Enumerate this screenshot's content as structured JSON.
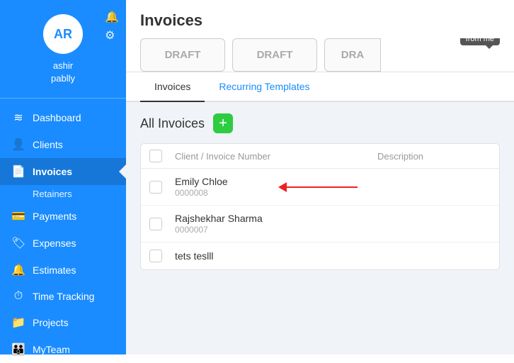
{
  "sidebar": {
    "avatar_initials": "AR",
    "username": "ashir",
    "company": "pablly",
    "nav_items": [
      {
        "id": "dashboard",
        "label": "Dashboard",
        "icon": "👤"
      },
      {
        "id": "clients",
        "label": "Clients",
        "icon": "👥"
      },
      {
        "id": "invoices",
        "label": "Invoices",
        "icon": "📄",
        "active": true
      },
      {
        "id": "retainers",
        "label": "Retainers",
        "sub": true
      },
      {
        "id": "payments",
        "label": "Payments",
        "icon": "💳"
      },
      {
        "id": "expenses",
        "label": "Expenses",
        "icon": "🏷"
      },
      {
        "id": "estimates",
        "label": "Estimates",
        "icon": "🔔"
      },
      {
        "id": "time-tracking",
        "label": "Time Tracking",
        "icon": "⏱"
      },
      {
        "id": "projects",
        "label": "Projects",
        "icon": "📁"
      },
      {
        "id": "my-team",
        "label": "MyTeam",
        "icon": "👪"
      }
    ]
  },
  "header": {
    "title": "Invoices",
    "draft_badges": [
      "DRAFT",
      "DRAFT",
      "DRA"
    ],
    "from_me_tooltip": "from me"
  },
  "tabs": [
    {
      "id": "invoices",
      "label": "Invoices",
      "active": true
    },
    {
      "id": "recurring",
      "label": "Recurring Templates",
      "highlighted": true
    }
  ],
  "all_invoices": {
    "section_title": "All Invoices",
    "add_btn_label": "+",
    "columns": [
      {
        "id": "client",
        "label": "Client / Invoice Number"
      },
      {
        "id": "desc",
        "label": "Description"
      }
    ],
    "rows": [
      {
        "name": "Emily Chloe",
        "invoice": "0000008",
        "has_arrow": true
      },
      {
        "name": "Rajshekhar Sharma",
        "invoice": "0000007",
        "has_arrow": false
      },
      {
        "name": "tets teslll",
        "invoice": "",
        "has_arrow": false
      }
    ]
  }
}
